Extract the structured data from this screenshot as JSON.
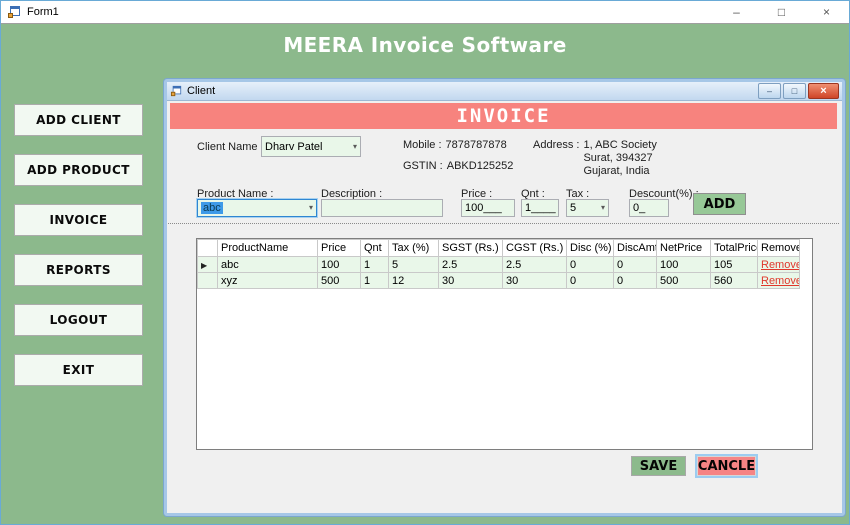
{
  "window": {
    "title": "Form1"
  },
  "icons": {
    "minimize": "–",
    "maximize": "□",
    "close": "×",
    "dropdown": "▾",
    "current_row_arrow": "▶"
  },
  "header": {
    "title": "MEERA Invoice Software"
  },
  "sidebar": {
    "items": [
      "ADD CLIENT",
      "ADD PRODUCT",
      "INVOICE",
      "REPORTS",
      "LOGOUT",
      "EXIT"
    ]
  },
  "client_window": {
    "title": "Client",
    "banner": "INVOICE",
    "client": {
      "name_label": "Client Name :",
      "name_value": "Dharv Patel",
      "mobile_label": "Mobile :",
      "mobile_value": "7878787878",
      "gstin_label": "GSTIN :",
      "gstin_value": "ABKD125252",
      "address_label": "Address :",
      "address_lines": [
        "1, ABC Society",
        "Surat, 394327",
        "Gujarat, India"
      ]
    },
    "product_entry": {
      "product_name_label": "Product Name :",
      "product_name_value": "abc",
      "description_label": "Description :",
      "description_value": "",
      "price_label": "Price :",
      "price_value": "100___",
      "qnt_label": "Qnt :",
      "qnt_value": "1____",
      "tax_label": "Tax :",
      "tax_value": "5",
      "discount_label": "Descount(%) :",
      "discount_value": "0_",
      "add_button": "ADD"
    },
    "grid": {
      "columns": [
        "ProductName",
        "Price",
        "Qnt",
        "Tax (%)",
        "SGST (Rs.)",
        "CGST (Rs.)",
        "Disc (%)",
        "DiscAmt",
        "NetPrice",
        "TotalPrice",
        "Remove"
      ],
      "rows": [
        {
          "cells": [
            "abc",
            "100",
            "1",
            "5",
            "2.5",
            "2.5",
            "0",
            "0",
            "100",
            "105"
          ],
          "action": "Remove"
        },
        {
          "cells": [
            "xyz",
            "500",
            "1",
            "12",
            "30",
            "30",
            "0",
            "0",
            "500",
            "560"
          ],
          "action": "Remove"
        }
      ]
    },
    "footer": {
      "save": "SAVE",
      "cancel": "CANCLE"
    }
  },
  "colors": {
    "app_green": "#8CB98C",
    "banner_red": "#F7837E",
    "selection_blue": "#3E9AE8",
    "save_green": "#8CBA8C",
    "cancel_red": "#F58484",
    "remove_red": "#E0372C",
    "field_green": "#E9F7E9"
  }
}
